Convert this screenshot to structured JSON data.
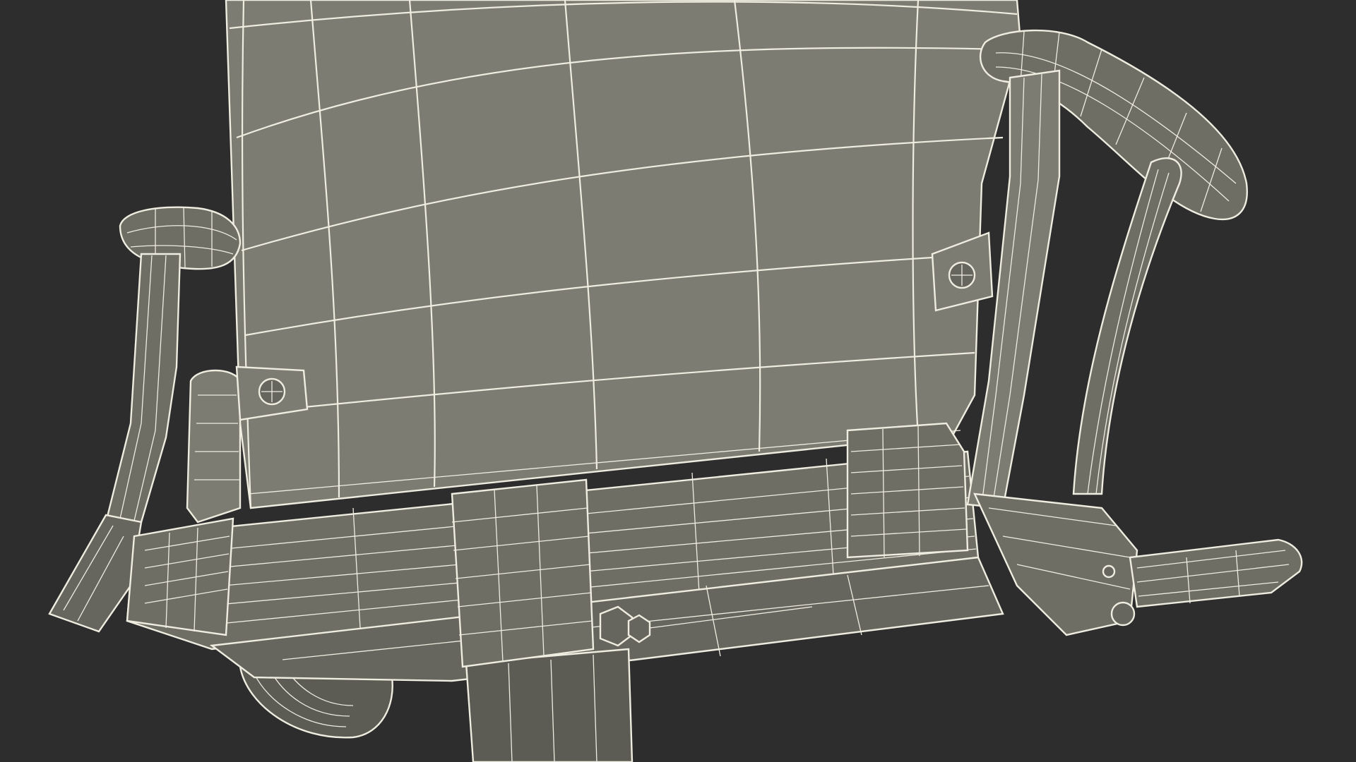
{
  "scene": {
    "subject": "office-chair-wireframe",
    "colors": {
      "background": "#2d2d2d",
      "surface_light": "#7c7c72",
      "surface_mid": "#6e6e65",
      "surface_dark": "#5c5c55",
      "wireframe": "#efece0"
    }
  }
}
